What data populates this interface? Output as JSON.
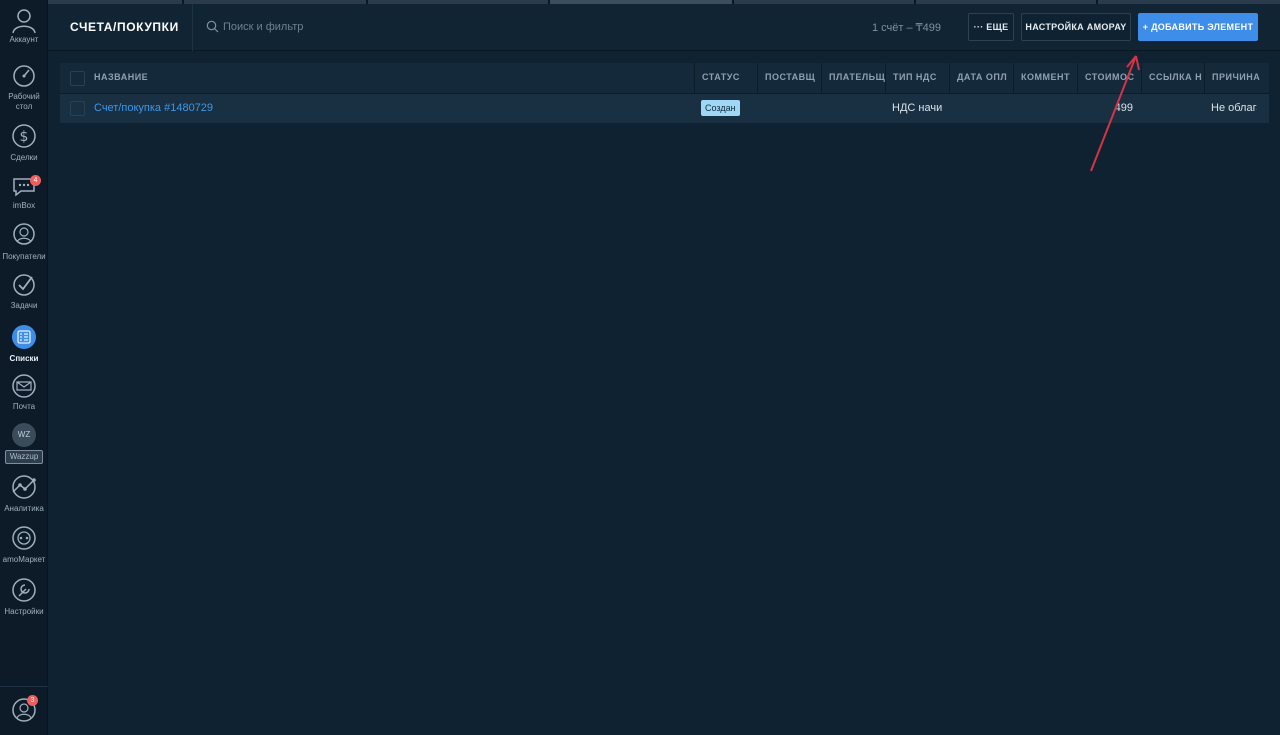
{
  "sidebar": {
    "account": "Аккаунт",
    "items": [
      {
        "label": "Рабочий стол",
        "icon": "dashboard-icon"
      },
      {
        "label": "Сделки",
        "icon": "dollar-icon"
      },
      {
        "label": "imBox",
        "icon": "chat-icon",
        "badge": "4"
      },
      {
        "label": "Покупатели",
        "icon": "customers-icon"
      },
      {
        "label": "Задачи",
        "icon": "tasks-icon"
      },
      {
        "label": "Списки",
        "icon": "lists-icon",
        "active": true
      },
      {
        "label": "Почта",
        "icon": "mail-icon"
      },
      {
        "label": "Wazzup",
        "icon": "wazzup-icon",
        "logo": "WZ"
      },
      {
        "label": "Аналитика",
        "icon": "analytics-icon"
      },
      {
        "label": "amoМаркет",
        "icon": "market-icon"
      },
      {
        "label": "Настройки",
        "icon": "settings-icon"
      }
    ],
    "notifications_badge": "3"
  },
  "header": {
    "title": "СЧЕТА/ПОКУПКИ",
    "search_placeholder": "Поиск и фильтр",
    "summary": "1 счёт – ₸499",
    "more_label": "··· ЕЩЕ",
    "amopay_label": "НАСТРОЙКА AMOPAY",
    "add_label": "+ ДОБАВИТЬ ЭЛЕМЕНТ"
  },
  "table": {
    "columns": [
      "НАЗВАНИЕ",
      "СТАТУС",
      "ПОСТАВЩ",
      "ПЛАТЕЛЬЩ",
      "ТИП НДС",
      "ДАТА ОПЛ",
      "КОММЕНТ",
      "СТОИМОС",
      "ССЫЛКА Н",
      "ПРИЧИНА"
    ],
    "rows": [
      {
        "name": "Счет/покупка #1480729",
        "status": "Создан",
        "supplier": "",
        "payer": "",
        "vat_type": "НДС начис",
        "payment_date": "",
        "comment": "",
        "cost": "499",
        "link": "",
        "reason": "Не облага"
      }
    ]
  },
  "colors": {
    "background": "#0f2231",
    "sidebar": "#0c1b27",
    "accent": "#3d8de9",
    "link": "#3f96e8",
    "status_badge": "#9fd7f5",
    "arrow": "#d63346",
    "badge": "#f05d5d"
  }
}
